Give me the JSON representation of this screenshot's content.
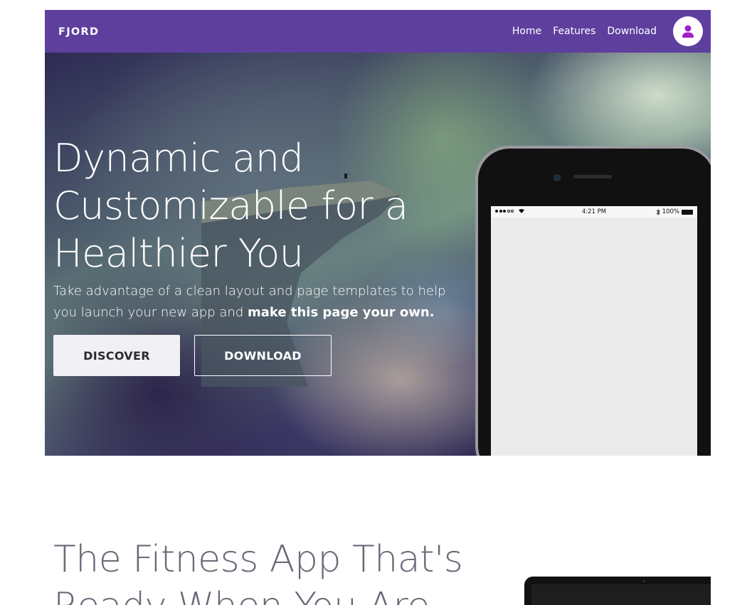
{
  "navbar": {
    "brand": "FJORD",
    "links": [
      "Home",
      "Features",
      "Download"
    ],
    "background_color": "#5e3f9e",
    "avatar_icon": "user-icon",
    "avatar_icon_color": "#a020c8"
  },
  "hero": {
    "title": "Dynamic and Customizable for a Healthier You",
    "subtitle_plain": "Take advantage of a clean layout and page templates to help you launch your new app and ",
    "subtitle_bold": "make this page your own.",
    "discover_label": "DISCOVER",
    "download_label": "DOWNLOAD"
  },
  "phone": {
    "status_time": "4:21 PM",
    "battery_text": "100%",
    "bluetooth_icon": "bluetooth-icon",
    "wifi_icon": "wifi-icon",
    "signal_icon": "signal-dots-icon",
    "battery_icon": "battery-icon"
  },
  "section": {
    "title": "The Fitness App That's Ready When You Are"
  }
}
